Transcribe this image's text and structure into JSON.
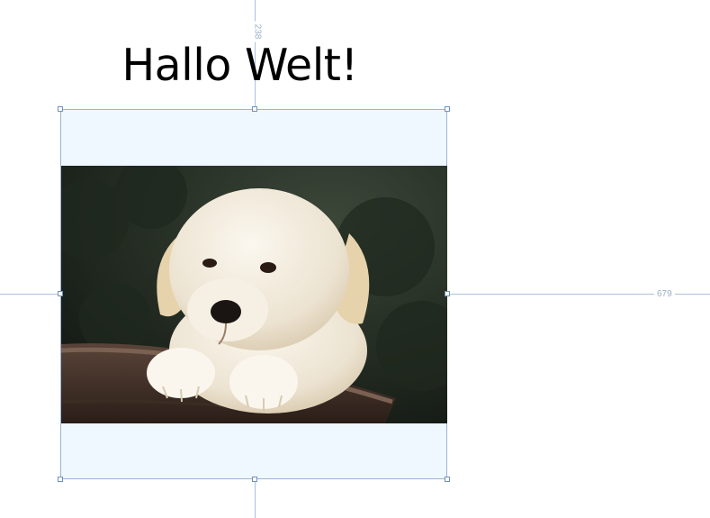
{
  "canvas": {
    "title": "Hallo Welt!",
    "guide_vertical_value": "238",
    "guide_horizontal_value": "679"
  },
  "image": {
    "subject": "golden retriever puppy in basket"
  },
  "colors": {
    "guide": "#a9c2df",
    "selection_fill": "#eff7ff",
    "selection_border": "#9ab4d6",
    "handle_border": "#6f91bd"
  },
  "icons": {
    "resize_handle": "square-handle-icon"
  }
}
